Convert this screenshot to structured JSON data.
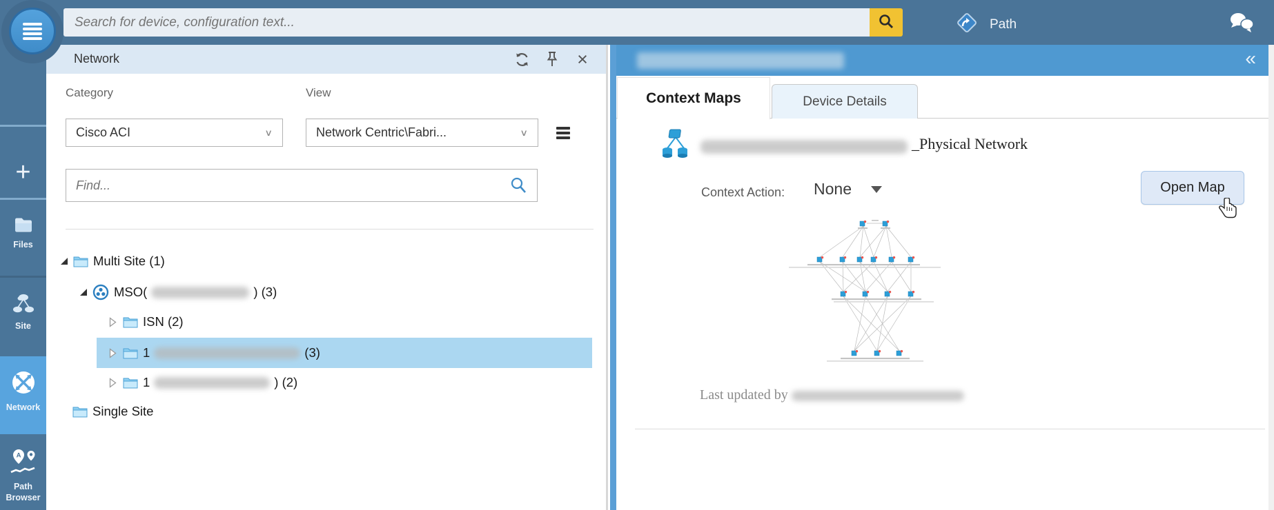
{
  "topbar": {
    "search_placeholder": "Search for device, configuration text...",
    "path_label": "Path"
  },
  "sidebar": {
    "items": [
      {
        "label": "+"
      },
      {
        "label": "Files"
      },
      {
        "label": "Site"
      },
      {
        "label": "Network",
        "active": true
      },
      {
        "label": "Path Browser"
      }
    ]
  },
  "network_panel": {
    "title": "Network",
    "category_label": "Category",
    "category_value": "Cisco ACI",
    "view_label": "View",
    "view_value": "Network Centric\\Fabri...",
    "find_placeholder": "Find...",
    "tree": [
      {
        "label": "Multi Site (1)",
        "expanded": true
      },
      {
        "prefix": "MSO(",
        "suffix": ") (3)",
        "expanded": true,
        "redacted": true
      },
      {
        "label": "ISN (2)",
        "collapsed": true
      },
      {
        "prefix": "1",
        "suffix": "(3)",
        "collapsed": true,
        "redacted": true,
        "selected": true
      },
      {
        "prefix": "1",
        "suffix": ") (2)",
        "collapsed": true,
        "redacted": true
      },
      {
        "label": "Single Site"
      }
    ]
  },
  "right_panel": {
    "title_redacted": true,
    "tabs": [
      {
        "label": "Context Maps",
        "active": true
      },
      {
        "label": "Device Details",
        "active": false
      }
    ],
    "map_name_suffix": "_Physical Network",
    "context_action_label": "Context Action:",
    "context_action_value": "None",
    "open_map_label": "Open Map",
    "last_updated_prefix": "Last updated by "
  },
  "colors": {
    "topbar": "#4a7498",
    "rail_active": "#58a4de",
    "search_button": "#f1c232",
    "panel_header": "#dbe8f4",
    "right_header": "#4f99d1",
    "tree_selection": "#abd7f1",
    "node_blue": "#2d9fd8"
  }
}
